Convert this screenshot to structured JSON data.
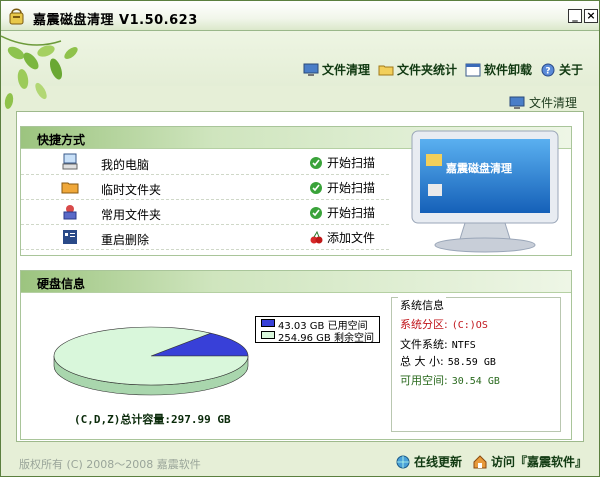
{
  "window": {
    "title": "嘉震磁盘清理 V1.50.623",
    "minimize_label": "_",
    "close_label": "×"
  },
  "topnav": [
    {
      "label": "文件清理",
      "icon": "monitor-icon"
    },
    {
      "label": "文件夹统计",
      "icon": "folder-icon"
    },
    {
      "label": "软件卸载",
      "icon": "window-icon"
    },
    {
      "label": "关于",
      "icon": "help-icon"
    }
  ],
  "breadcrumb": {
    "label": "文件清理"
  },
  "quick": {
    "title": "快捷方式",
    "items": [
      {
        "label": "我的电脑",
        "action": "开始扫描",
        "icon": "computer-icon"
      },
      {
        "label": "临时文件夹",
        "action": "开始扫描",
        "icon": "folder-icon"
      },
      {
        "label": "常用文件夹",
        "action": "开始扫描",
        "icon": "shared-folder-icon"
      },
      {
        "label": "重启删除",
        "action": "添加文件",
        "icon": "recycle-icon"
      }
    ]
  },
  "monitor_label": "嘉震磁盘清理",
  "disk": {
    "title": "硬盘信息",
    "legend": {
      "used": "43.03 GB 已用空间",
      "free": "254.96 GB 剩余空间"
    },
    "total": "(C,D,Z)总计容量:297.99 GB",
    "colors": {
      "used": "#3840d8",
      "free": "#d9f7db"
    }
  },
  "chart_data": {
    "type": "pie",
    "title": "",
    "categories": [
      "已用空间",
      "剩余空间"
    ],
    "values": [
      43.03,
      254.96
    ]
  },
  "sysinfo": {
    "title": "系统信息",
    "partition_label": "系统分区:",
    "partition_value": "(C:)OS",
    "fs_label": "文件系统:",
    "fs_value": "NTFS",
    "size_label": "总 大 小:",
    "size_value": "58.59 GB",
    "free_label": "可用空间:",
    "free_value": "30.54 GB"
  },
  "footer": {
    "copyright": "版权所有 (C) 2008～2008 嘉震软件",
    "update": "在线更新",
    "visit": "访问『嘉震软件』"
  }
}
